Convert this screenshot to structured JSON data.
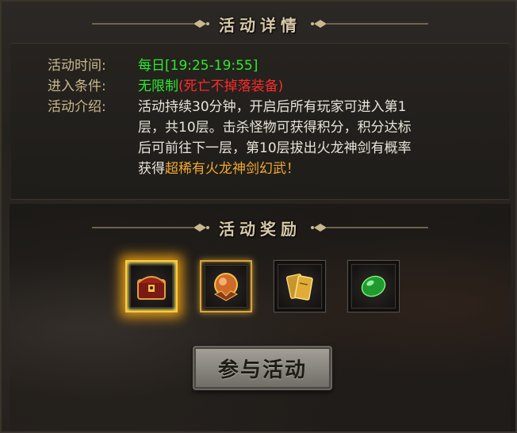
{
  "details": {
    "title": "活动详情",
    "time_label": "活动时间:",
    "time_value": "每日[19:25-19:55]",
    "condition_label": "进入条件:",
    "condition_value": "无限制",
    "condition_note": "(死亡不掉落装备)",
    "intro_label": "活动介绍:",
    "intro_line1": "活动持续30分钟，开启后所有玩家可进入第1",
    "intro_line2": "层，共10层。击杀怪物可获得积分，积分达标",
    "intro_line3": "后可前往下一层，第10层拔出火龙神剑有概率",
    "intro_line4_prefix": "获得",
    "intro_line4_highlight": "超稀有火龙神剑幻武！"
  },
  "rewards": {
    "title": "活动奖励",
    "items": [
      {
        "icon": "treasure-chest-icon",
        "frame": "fire"
      },
      {
        "icon": "dragon-orb-icon",
        "frame": "gold"
      },
      {
        "icon": "gold-tickets-icon",
        "frame": "plain"
      },
      {
        "icon": "green-gem-icon",
        "frame": "plain"
      }
    ]
  },
  "join_button_label": "参与活动",
  "colors": {
    "label": "#c9b88c",
    "time": "#2ee82e",
    "condition_note": "#ff2a2a",
    "highlight": "#f0a830"
  }
}
